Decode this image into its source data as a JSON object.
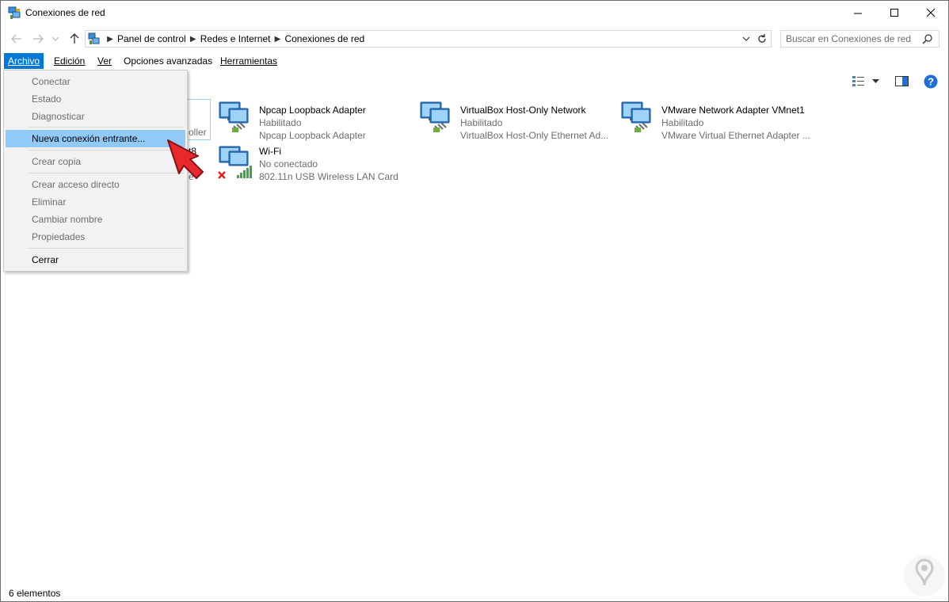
{
  "window": {
    "title": "Conexiones de red",
    "app_icon": "network-connections-icon"
  },
  "address": {
    "breadcrumbs": [
      "Panel de control",
      "Redes e Internet",
      "Conexiones de red"
    ],
    "search_placeholder": "Buscar en Conexiones de red"
  },
  "menubar": {
    "items": [
      {
        "label": "Archivo",
        "active": true
      },
      {
        "label": "Edición"
      },
      {
        "label": "Ver"
      },
      {
        "label": "Opciones avanzadas"
      },
      {
        "label": "Herramientas"
      }
    ]
  },
  "file_menu": {
    "items": [
      {
        "label": "Conectar",
        "enabled": false
      },
      {
        "label": "Estado",
        "enabled": false
      },
      {
        "label": "Diagnosticar",
        "enabled": false
      },
      {
        "label": "Nueva conexión entrante...",
        "enabled": true,
        "highlighted": true
      },
      {
        "label": "Crear copia",
        "enabled": false
      },
      {
        "label": "Crear acceso directo",
        "enabled": false
      },
      {
        "label": "Eliminar",
        "enabled": false
      },
      {
        "label": "Cambiar nombre",
        "enabled": false
      },
      {
        "label": "Propiedades",
        "enabled": false
      },
      {
        "label": "Cerrar",
        "enabled": true
      }
    ]
  },
  "adapters": [
    {
      "name": "Npcap Loopback Adapter",
      "status": "Habilitado",
      "device": "Npcap Loopback Adapter"
    },
    {
      "name": "VirtualBox Host-Only Network",
      "status": "Habilitado",
      "device": "VirtualBox Host-Only Ethernet Ad..."
    },
    {
      "name": "VMware Network Adapter VMnet1",
      "status": "Habilitado",
      "device": "VMware Virtual Ethernet Adapter ..."
    },
    {
      "name": "Wi-Fi",
      "status": "No conectado",
      "device": "802.11n USB Wireless LAN Card"
    }
  ],
  "hidden_fragments": {
    "first_adapter_tail": "oller",
    "second_adapter_tail": "t8",
    "second_adapter_status_tail": "e"
  },
  "statusbar": {
    "count": "6 elementos"
  },
  "colors": {
    "menu_active": "#0078d7",
    "menu_highlight": "#91c9f7",
    "disabled_text": "#6d6d6d",
    "help": "#1e6fd9"
  }
}
